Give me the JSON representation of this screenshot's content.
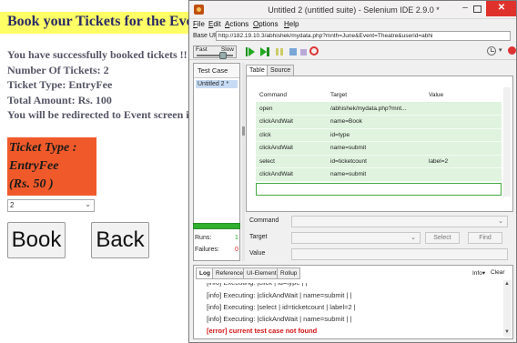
{
  "webpage": {
    "heading": "Book your Tickets for the Event",
    "lines": [
      "You have successfully booked tickets !!",
      "Number Of Tickets: 2",
      "Ticket Type: EntryFee",
      "Total Amount: Rs. 100",
      "You will be redirected to Event screen in"
    ],
    "ticket_box": [
      "Ticket Type :",
      "EntryFee",
      "(Rs. 50 )"
    ],
    "quantity_value": "2",
    "book_label": "Book",
    "back_label": "Back"
  },
  "ide": {
    "window_title": "Untitled 2 (untitled suite) - Selenium IDE 2.9.0 *",
    "menu": [
      "File",
      "Edit",
      "Actions",
      "Options",
      "Help"
    ],
    "base_url_label": "Base URL",
    "base_url": "http://182.19.10.3/abhishek/mydata.php?mnth=June&Event=Theatre&userid=abhi",
    "speed": {
      "fast": "Fast",
      "slow": "Slow"
    },
    "test_case_header": "Test Case",
    "test_cases": [
      "Untitled 2 *"
    ],
    "runs_label": "Runs:",
    "runs_value": "1",
    "failures_label": "Failures:",
    "failures_value": "0",
    "tabs": [
      "Table",
      "Source"
    ],
    "columns": [
      "Command",
      "Target",
      "Value"
    ],
    "rows": [
      [
        "open",
        "/abhishek/mydata.php?mnt...",
        ""
      ],
      [
        "clickAndWait",
        "name=Book",
        ""
      ],
      [
        "click",
        "id=type",
        ""
      ],
      [
        "clickAndWait",
        "name=submit",
        ""
      ],
      [
        "select",
        "id=ticketcount",
        "label=2"
      ],
      [
        "clickAndWait",
        "name=submit",
        ""
      ]
    ],
    "command_label": "Command",
    "target_label": "Target",
    "value_label": "Value",
    "select_button": "Select",
    "find_button": "Find",
    "log_tabs": [
      "Log",
      "Reference",
      "UI-Element",
      "Rollup"
    ],
    "info_label": "Info",
    "clear_label": "Clear",
    "log_lines": [
      "[info] Executing: |click | id=type | |",
      "[info] Executing: |clickAndWait | name=submit | |",
      "[info] Executing: |select | id=ticketcount | label=2 |",
      "[info] Executing: |clickAndWait | name=submit | |"
    ],
    "log_error": "[error] current test case not found"
  }
}
